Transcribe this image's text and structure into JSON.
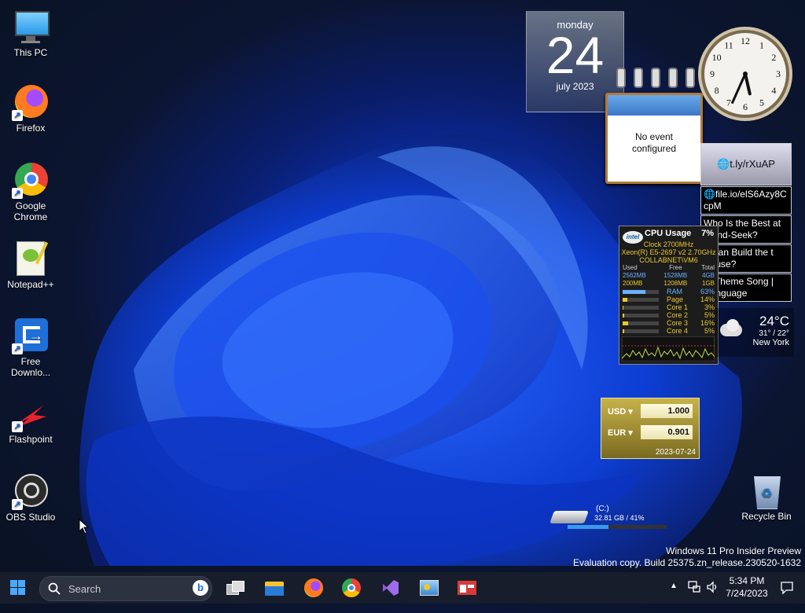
{
  "desktop": {
    "icons": [
      {
        "label": "This PC"
      },
      {
        "label": "Firefox"
      },
      {
        "label": "Google Chrome"
      },
      {
        "label": "Notepad++"
      },
      {
        "label": "Free Downlo..."
      },
      {
        "label": "Flashpoint"
      },
      {
        "label": "OBS Studio"
      }
    ],
    "recycle_bin": "Recycle Bin"
  },
  "calendar": {
    "weekday": "monday",
    "day": "24",
    "month": "july 2023"
  },
  "notes": {
    "text_line1": "No event",
    "text_line2": "configured"
  },
  "clock": {
    "hour": 5,
    "minute": 34,
    "second": 0
  },
  "feed": {
    "header": "t.ly/rXuAP",
    "items": [
      "file.io/elS6Azy8C cpM",
      "Who Is the Best at e-and-Seek?",
      "o Can Build the t House?",
      "ur Theme Song | tilanguage"
    ]
  },
  "cpu": {
    "logo": "intel",
    "title": "CPU Usage",
    "percent": "7%",
    "clock": "Clock 2700MHz",
    "model": "Xeon(R) E5-2697 v2 2.70GHz",
    "host": "COLLABNET\\VM6",
    "headers": [
      "Used",
      "Free",
      "Total"
    ],
    "mem_rows": [
      {
        "used": "2562MB",
        "free": "1528MB",
        "total": "4GB"
      },
      {
        "used": "200MB",
        "free": "1208MB",
        "total": "1GB"
      }
    ],
    "bars": [
      {
        "label": "RAM",
        "value": "63%",
        "fraction": 0.63
      },
      {
        "label": "Page",
        "value": "14%",
        "fraction": 0.14
      },
      {
        "label": "Core 1",
        "value": "3%",
        "fraction": 0.03
      },
      {
        "label": "Core 2",
        "value": "5%",
        "fraction": 0.05
      },
      {
        "label": "Core 3",
        "value": "16%",
        "fraction": 0.16
      },
      {
        "label": "Core 4",
        "value": "5%",
        "fraction": 0.05
      }
    ]
  },
  "weather": {
    "temp": "24°C",
    "range": "31° / 22°",
    "city": "New York"
  },
  "currency": {
    "from": "USD",
    "from_value": "1.000",
    "to": "EUR",
    "to_value": "0.901",
    "date": "2023-07-24"
  },
  "drive": {
    "label": "(C:)",
    "usage": "32.81 GB / 41%",
    "fraction": 0.41
  },
  "watermark": {
    "line1": "Windows 11 Pro Insider Preview",
    "line2": "Evaluation copy. Build 25375.zn_release.230520-1632"
  },
  "taskbar": {
    "search_label": "Search",
    "time": "5:34 PM",
    "date": "7/24/2023"
  },
  "icons": {
    "start": "windows-logo-icon",
    "search": "search-icon",
    "bing": "bing-icon",
    "task_view": "task-view-icon",
    "explorer": "file-explorer-icon",
    "firefox": "firefox-icon",
    "chrome": "chrome-icon",
    "vs": "visual-studio-icon",
    "control": "control-panel-icon",
    "gadgets": "gadgets-icon"
  }
}
